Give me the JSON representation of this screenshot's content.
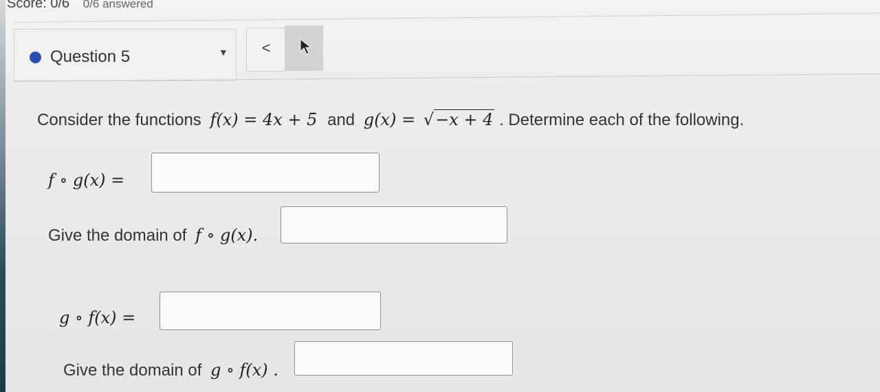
{
  "header": {
    "score": "Score: 0/6",
    "answered": "0/6 answered"
  },
  "question_nav": {
    "label": "Question 5",
    "dropdown_icon": "caret-down-icon",
    "prev_label": "<",
    "next_icon": "cursor-arrow-icon"
  },
  "problem": {
    "intro": "Consider the functions",
    "f_def": "f(x) = 4x + 5",
    "and": "and",
    "g_def": "g(x) = ",
    "g_sqrt": "−x + 4",
    "outro": ". Determine each of the following."
  },
  "parts": [
    {
      "prompt": "f ∘ g(x) =",
      "text_prefix": "",
      "answer": ""
    },
    {
      "prompt": "f ∘ g(x).",
      "text_prefix": "Give the domain of",
      "answer": ""
    },
    {
      "prompt": "g ∘ f(x) =",
      "text_prefix": "",
      "answer": ""
    },
    {
      "prompt": "g ∘ f(x) .",
      "text_prefix": "Give the domain of",
      "answer": ""
    }
  ],
  "colors": {
    "accent_dot": "#2b4fb0",
    "box_border": "#8f8f8f"
  }
}
